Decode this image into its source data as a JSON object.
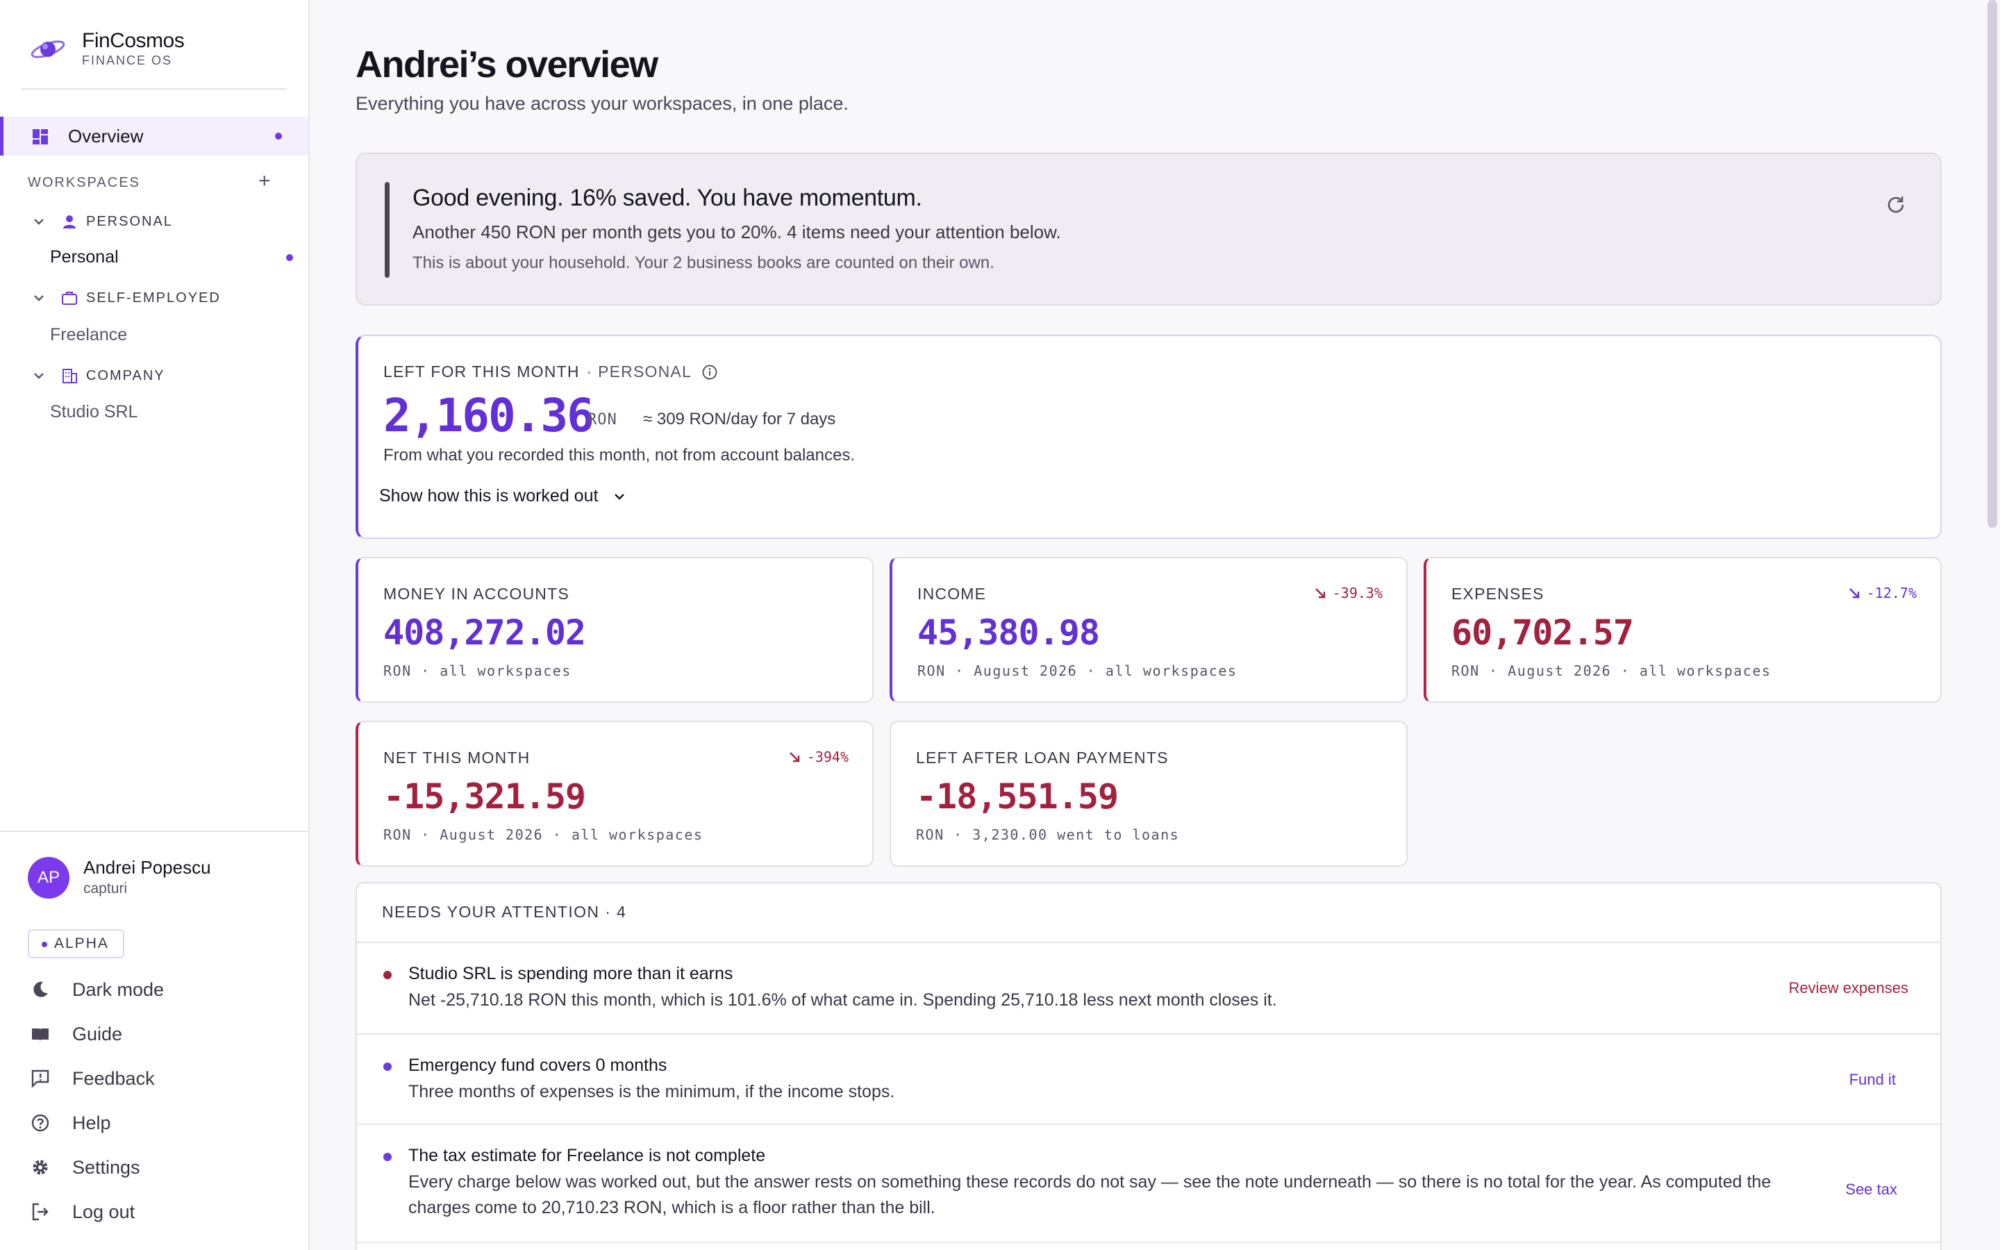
{
  "brand": {
    "name": "FinCosmos",
    "tagline": "FINANCE OS"
  },
  "sidebar": {
    "overview_label": "Overview",
    "workspaces_header": "WORKSPACES",
    "add_symbol": "+",
    "groups": [
      {
        "label": "PERSONAL",
        "items": [
          "Personal"
        ]
      },
      {
        "label": "SELF-EMPLOYED",
        "items": [
          "Freelance"
        ]
      },
      {
        "label": "COMPANY",
        "items": [
          "Studio SRL"
        ]
      }
    ],
    "user": {
      "initials": "AP",
      "name": "Andrei Popescu",
      "handle": "capturi"
    },
    "badge": "ALPHA",
    "links": [
      "Dark mode",
      "Guide",
      "Feedback",
      "Help",
      "Settings",
      "Log out"
    ]
  },
  "header": {
    "title": "Andrei’s overview",
    "subtitle": "Everything you have across your workspaces, in one place."
  },
  "banner": {
    "title": "Good evening. 16% saved. You have momentum.",
    "line": "Another 450 RON per month gets you to 20%. 4 items need your attention below.",
    "note": "This is about your household. Your 2 business books are counted on their own."
  },
  "left_for_month": {
    "label": "LEFT FOR THIS MONTH",
    "workspace": "· PERSONAL",
    "amount": "2,160.36",
    "unit": "RON",
    "per_day": "≈ 309 RON/day for 7 days",
    "source_note": "From what you recorded this month, not from account balances.",
    "expand_label": "Show how this is worked out"
  },
  "stats": [
    {
      "label": "MONEY IN ACCOUNTS",
      "value": "408,272.02",
      "sub": "RON · all workspaces",
      "trend": "",
      "tone": "purple"
    },
    {
      "label": "INCOME",
      "value": "45,380.98",
      "sub": "RON · August 2026 · all workspaces",
      "trend": "-39.3%",
      "tone": "purple",
      "trend_tone": "red"
    },
    {
      "label": "EXPENSES",
      "value": "60,702.57",
      "sub": "RON · August 2026 · all workspaces",
      "trend": "-12.7%",
      "tone": "red",
      "trend_tone": "purple"
    },
    {
      "label": "NET THIS MONTH",
      "value": "-15,321.59",
      "sub": "RON · August 2026 · all workspaces",
      "trend": "-394%",
      "tone": "red",
      "trend_tone": "red"
    },
    {
      "label": "LEFT AFTER LOAN PAYMENTS",
      "value": "-18,551.59",
      "sub": "RON · 3,230.00 went to loans",
      "trend": "",
      "tone": "red"
    }
  ],
  "attention": {
    "header": "NEEDS YOUR ATTENTION · 4",
    "items": [
      {
        "title": "Studio SRL is spending more than it earns",
        "detail": "Net -25,710.18 RON this month, which is 101.6% of what came in. Spending 25,710.18 less next month closes it.",
        "action": "Review expenses",
        "tone": "red"
      },
      {
        "title": "Emergency fund covers 0 months",
        "detail": "Three months of expenses is the minimum, if the income stops.",
        "action": "Fund it",
        "tone": "purple"
      },
      {
        "title": "The tax estimate for Freelance is not complete",
        "detail": "Every charge below was worked out, but the answer rests on something these records do not say — see the note underneath — so there is no total for the year. As computed the charges come to 20,710.23 RON, which is a floor rather than the bill.",
        "action": "See tax",
        "tone": "purple"
      }
    ]
  },
  "colors": {
    "accent": "#6d3ae0",
    "accent_text": "#6230d6",
    "negative": "#a2213f",
    "background": "#f8f7fa"
  },
  "icons": {
    "brand": "planet-logo-icon",
    "overview": "dashboard-grid-icon",
    "refresh": "refresh-icon",
    "info": "info-icon",
    "personal": "person-icon",
    "self_employed": "briefcase-icon",
    "company": "building-icon"
  }
}
